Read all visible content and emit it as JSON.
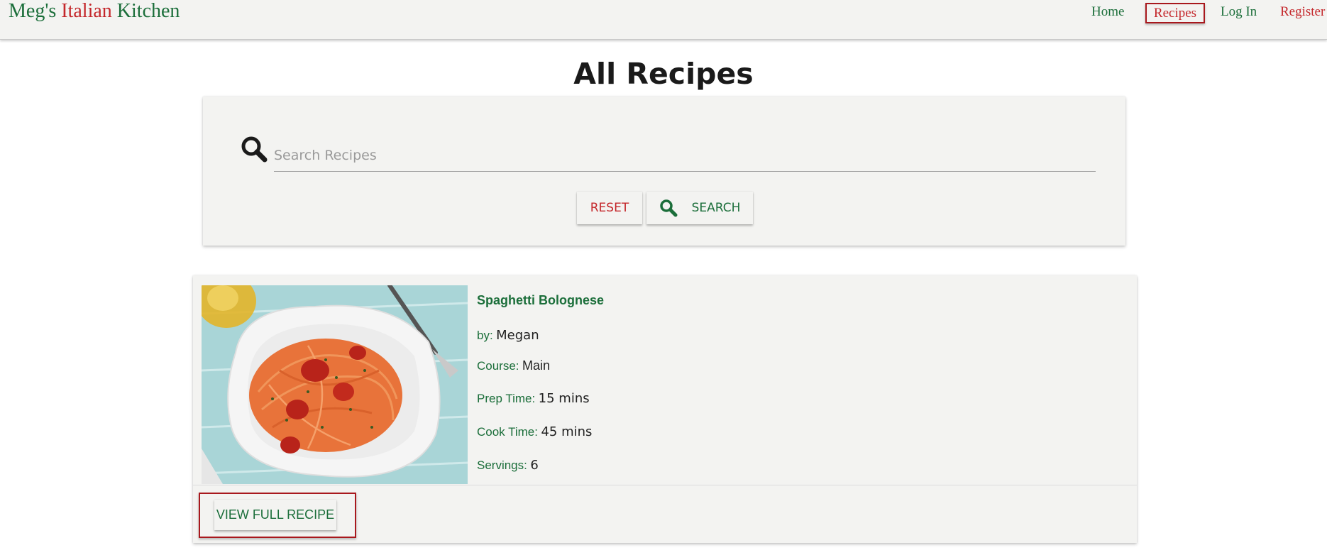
{
  "brand": {
    "part1": "Meg's",
    "part2": "Italian",
    "part3": "Kitchen"
  },
  "nav": {
    "home": "Home",
    "recipes": "Recipes",
    "login": "Log In",
    "register": "Register"
  },
  "page_title": "All Recipes",
  "search": {
    "placeholder": "Search Recipes",
    "reset_label": "RESET",
    "search_label": "SEARCH"
  },
  "recipes": [
    {
      "title": "Spaghetti Bolognese",
      "by_label": "by:",
      "author": "Megan",
      "course_label": "Course:",
      "course": "Main",
      "prep_label": "Prep Time:",
      "prep_time": "15 mins",
      "cook_label": "Cook Time:",
      "cook_time": "45 mins",
      "servings_label": "Servings:",
      "servings": "6",
      "view_label": "VIEW FULL RECIPE"
    }
  ],
  "colors": {
    "green": "#1b6e3a",
    "red": "#c4272b",
    "panel": "#f3f3f1"
  }
}
